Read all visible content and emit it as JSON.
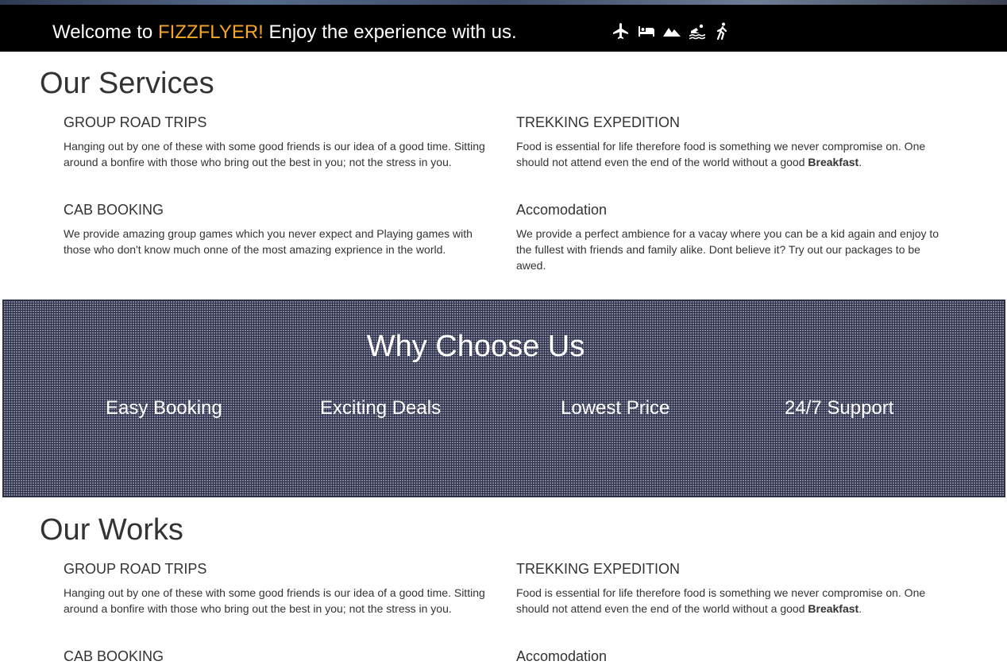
{
  "header": {
    "welcome_prefix": "Welcome to ",
    "brand": "FIZZFLYER!",
    "welcome_suffix": " Enjoy the experience with us.",
    "icons": [
      "plane-icon",
      "bed-icon",
      "mountain-icon",
      "swimmer-icon",
      "hiker-icon"
    ]
  },
  "services": {
    "title": "Our Services",
    "items": [
      {
        "title": "GROUP ROAD TRIPS",
        "text": "Hanging out by one of these with some good friends is our idea of a good time. Sitting around a bonfire with those who bring out the best in you; not the stress in you."
      },
      {
        "title": "TREKKING EXPEDITION",
        "text_before": "Food is essential for life therefore food is something we never compromise on. One should not attend even the end of the world without a good ",
        "text_bold": "Breakfast",
        "text_after": "."
      },
      {
        "title": "CAB BOOKING",
        "text": "We provide amazing group games which you never expect and Playing games with those who don't know much onne of the most amazing exprience in the world."
      },
      {
        "title": "Accomodation",
        "text": "We provide a perfect ambience for a vacay where you can be a kid again and enjoy to the fullest with friends and family alike. Dont believe it? Try out our packages to be awed."
      }
    ]
  },
  "why": {
    "title": "Why Choose Us",
    "features": [
      "Easy Booking",
      "Exciting Deals",
      "Lowest Price",
      "24/7 Support"
    ]
  },
  "works": {
    "title": "Our Works",
    "items": [
      {
        "title": "GROUP ROAD TRIPS",
        "text": "Hanging out by one of these with some good friends is our idea of a good time. Sitting around a bonfire with those who bring out the best in you; not the stress in you."
      },
      {
        "title": "TREKKING EXPEDITION",
        "text_before": "Food is essential for life therefore food is something we never compromise on. One should not attend even the end of the world without a good ",
        "text_bold": "Breakfast",
        "text_after": "."
      },
      {
        "title": "CAB BOOKING"
      },
      {
        "title": "Accomodation"
      }
    ]
  },
  "colors": {
    "header_bg": "#000000",
    "brand_accent": "#f5a623",
    "text": "#333333",
    "why_bg": "#7d8096"
  }
}
